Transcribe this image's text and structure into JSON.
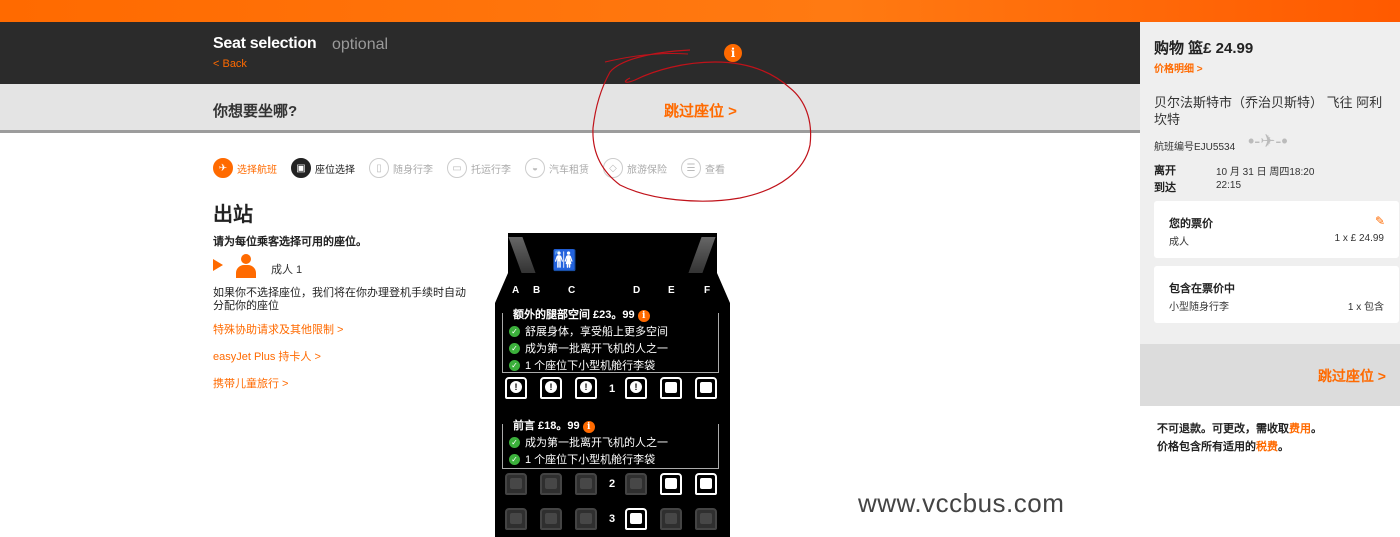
{
  "header": {
    "title": "Seat selection",
    "optional": "optional",
    "back": "< Back"
  },
  "question": {
    "text": "你想要坐哪?",
    "skip": "跳过座位 >"
  },
  "steps": [
    {
      "label": "选择航班",
      "icon": "plane-icon"
    },
    {
      "label": "座位选择",
      "icon": "seat-icon"
    },
    {
      "label": "随身行李",
      "icon": "bag-icon"
    },
    {
      "label": "托运行李",
      "icon": "suitcase-icon"
    },
    {
      "label": "汽车租赁",
      "icon": "car-icon"
    },
    {
      "label": "旅游保险",
      "icon": "shield-icon"
    },
    {
      "label": "查看",
      "icon": "review-icon"
    }
  ],
  "outbound": {
    "title": "出站",
    "instruction": "请为每位乘客选择可用的座位。",
    "passenger": "成人 1",
    "note": "如果你不选择座位，我们将在你办理登机手续时自动分配你的座位",
    "links": [
      "特殊协助请求及其他限制 >",
      "easyJet Plus 持卡人 >",
      "携带儿童旅行 >"
    ]
  },
  "seatmap": {
    "columns": [
      "A",
      "B",
      "C",
      "D",
      "E",
      "F"
    ],
    "extra_legroom": {
      "title": "额外的腿部空间 £23。99",
      "features": [
        "舒展身体，享受船上更多空间",
        "成为第一批离开飞机的人之一",
        "1 个座位下小型机舱行李袋"
      ]
    },
    "up_front": {
      "title": "前言 £18。99",
      "features": [
        "成为第一批离开飞机的人之一",
        "1 个座位下小型机舱行李袋"
      ]
    },
    "rows": [
      {
        "num": "1",
        "seats": [
          "x",
          "x",
          "x",
          "x",
          "w",
          "w"
        ]
      },
      {
        "num": "2",
        "seats": [
          "g",
          "g",
          "g",
          "g",
          "w",
          "w"
        ]
      },
      {
        "num": "3",
        "seats": [
          "g",
          "g",
          "g",
          "w",
          "g",
          "g"
        ]
      }
    ]
  },
  "watermark": "www.vccbus.com",
  "cart": {
    "title": "购物 篮£ 24.99",
    "price_breakdown": "价格明细 >",
    "route": "贝尔法斯特市（乔治贝斯特） 飞往 阿利坎特",
    "flight_number": "航班编号EJU5534",
    "depart_label": "离开",
    "depart_value": "10 月 31 日 周四18:20",
    "arrive_label": "到达",
    "arrive_value": "22:15",
    "fare": {
      "title": "您的票价",
      "label": "成人",
      "value": "1 x £ 24.99"
    },
    "included": {
      "title": "包含在票价中",
      "label": "小型随身行李",
      "value": "1 x 包含"
    },
    "skip": "跳过座位 >",
    "note1_a": "不可退款。可更改，需收取",
    "note1_b": "费用",
    "note1_c": "。",
    "note2_a": "价格包含所有适用的",
    "note2_b": "税费",
    "note2_c": "。"
  },
  "colors": {
    "accent": "#ff6a00",
    "header": "#2b2b2b",
    "scribble": "#c0121a"
  }
}
